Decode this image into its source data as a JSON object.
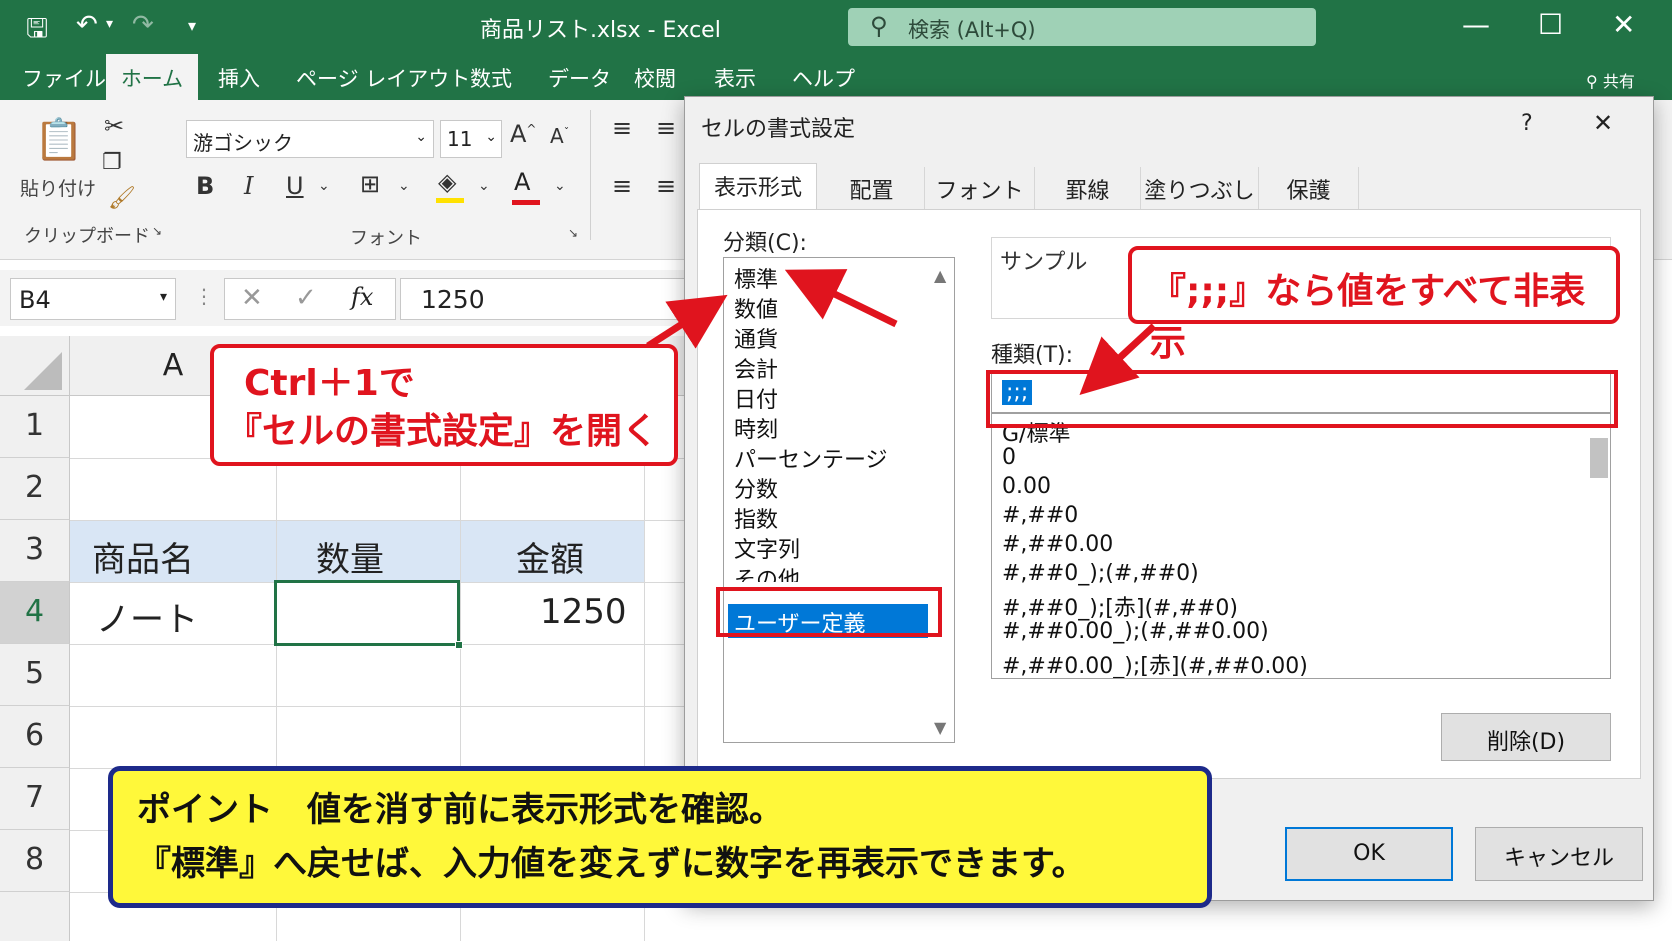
{
  "window": {
    "title": "商品リスト.xlsx  -  Excel",
    "search_placeholder": "検索 (Alt+Q)"
  },
  "ribbon_tabs": [
    "ファイル",
    "ホーム",
    "挿入",
    "ページ レイアウト",
    "数式",
    "データ",
    "校閲",
    "表示",
    "ヘルプ"
  ],
  "share_label": "共有",
  "ribbon": {
    "paste_label": "貼り付け",
    "clipboard_group": "クリップボード",
    "font_group": "フォント",
    "font_name": "游ゴシック",
    "font_size": "11",
    "bold": "B",
    "italic": "I",
    "underline": "U"
  },
  "formula_bar": {
    "name_box": "B4",
    "formula": "1250"
  },
  "grid": {
    "col_header": "A",
    "rows": [
      "1",
      "2",
      "3",
      "4",
      "5",
      "6",
      "7",
      "8"
    ],
    "headers": [
      "商品名",
      "数量",
      "金額"
    ],
    "row4": [
      "ノート",
      "",
      "1250"
    ]
  },
  "dialog": {
    "title": "セルの書式設定",
    "help": "?",
    "close": "✕",
    "tabs": [
      "表示形式",
      "配置",
      "フォント",
      "罫線",
      "塗りつぶし",
      "保護"
    ],
    "category_label": "分類(C):",
    "categories": [
      "標準",
      "数値",
      "通貨",
      "会計",
      "日付",
      "時刻",
      "パーセンテージ",
      "分数",
      "指数",
      "文字列",
      "その他"
    ],
    "selected_category": "ユーザー定義",
    "sample_label": "サンプル",
    "type_label": "種類(T):",
    "type_value": ";;;",
    "type_list": [
      "G/標準",
      "0",
      "0.00",
      "#,##0",
      "#,##0.00",
      "#,##0_);(#,##0)",
      "#,##0_);[赤](#,##0)",
      "#,##0.00_);(#,##0.00)",
      "#,##0.00_);[赤](#,##0.00)"
    ],
    "delete_button": "削除(D)",
    "ok_button": "OK",
    "cancel_button": "キャンセル"
  },
  "annotations": {
    "callout1_line1": "Ctrl＋1で",
    "callout1_line2": "『セルの書式設定』を開く",
    "callout2": "『;;;』なら値をすべて非表示",
    "point_line1": "ポイント　値を消す前に表示形式を確認。",
    "point_line2": "『標準』へ戻せば、入力値を変えずに数字を再表示できます。"
  },
  "colors": {
    "excel_green": "#217346",
    "accent_red": "#e0141e",
    "select_blue": "#0078d7",
    "point_yellow": "#fff83a",
    "point_border": "#1d2a8a"
  }
}
